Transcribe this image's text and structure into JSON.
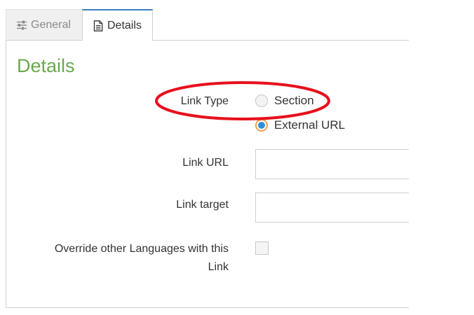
{
  "tabs": {
    "general": {
      "label": "General",
      "icon": "sliders-icon"
    },
    "details": {
      "label": "Details",
      "icon": "document-icon"
    }
  },
  "section": {
    "title": "Details"
  },
  "form": {
    "link_type": {
      "label": "Link Type",
      "options": [
        {
          "label": "Section",
          "checked": false
        },
        {
          "label": "External URL",
          "checked": true
        }
      ]
    },
    "link_url": {
      "label": "Link URL",
      "value": "",
      "placeholder": ""
    },
    "link_target": {
      "label": "Link target",
      "value": "",
      "placeholder": ""
    },
    "override": {
      "label_line1": "Override other Languages with this",
      "label_line2": "Link",
      "checked": false
    }
  },
  "colors": {
    "title_green": "#6aa84f",
    "active_tab_border": "#3a7fc1",
    "radio_checked_fill": "#2f8fd8",
    "radio_checked_ring": "#f0a050",
    "annotation_red": "#e8101c"
  }
}
